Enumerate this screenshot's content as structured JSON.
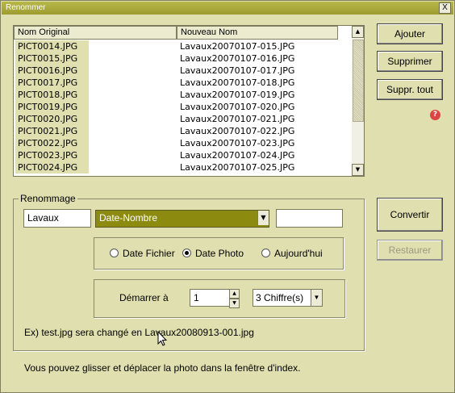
{
  "window": {
    "title": "Renommer",
    "close_label": "X"
  },
  "table": {
    "columns": [
      "Nom Original",
      "Nouveau Nom"
    ],
    "rows": [
      [
        "PICT0014.JPG",
        "Lavaux20070107-015.JPG"
      ],
      [
        "PICT0015.JPG",
        "Lavaux20070107-016.JPG"
      ],
      [
        "PICT0016.JPG",
        "Lavaux20070107-017.JPG"
      ],
      [
        "PICT0017.JPG",
        "Lavaux20070107-018.JPG"
      ],
      [
        "PICT0018.JPG",
        "Lavaux20070107-019.JPG"
      ],
      [
        "PICT0019.JPG",
        "Lavaux20070107-020.JPG"
      ],
      [
        "PICT0020.JPG",
        "Lavaux20070107-021.JPG"
      ],
      [
        "PICT0021.JPG",
        "Lavaux20070107-022.JPG"
      ],
      [
        "PICT0022.JPG",
        "Lavaux20070107-023.JPG"
      ],
      [
        "PICT0023.JPG",
        "Lavaux20070107-024.JPG"
      ],
      [
        "PICT0024.JPG",
        "Lavaux20070107-025.JPG"
      ]
    ]
  },
  "buttons": {
    "add": "Ajouter",
    "remove": "Supprimer",
    "remove_all": "Suppr. tout",
    "convert": "Convertir",
    "restore": "Restaurer"
  },
  "rename": {
    "group_label": "Renommage",
    "prefix_value": "Lavaux",
    "format_value": "Date-Nombre",
    "suffix_value": "",
    "date_options": [
      "Date Fichier",
      "Date Photo",
      "Aujourd'hui"
    ],
    "selected_date": "Date Photo",
    "start_label": "Démarrer à",
    "start_value": "1",
    "digits_value": "3 Chiffre(s)",
    "example": "Ex) test.jpg sera changé en Lavaux20080913-001.jpg"
  },
  "footer_hint": "Vous pouvez glisser et déplacer la photo dans la fenêtre d'index.",
  "icons": {
    "help": "help-icon",
    "close": "close-icon"
  }
}
